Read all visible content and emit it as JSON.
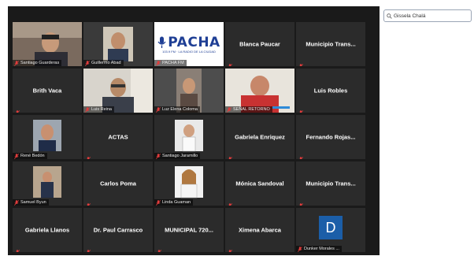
{
  "search": {
    "value": "Gissela Chalá",
    "placeholder": ""
  },
  "colors": {
    "gallery_bg": "#1a1a1a",
    "tile_bg": "#2b2b2b",
    "muted_red": "#e03c3c",
    "avatar_blue": "#1b5ea8"
  },
  "logo": {
    "text": "PACHA",
    "tagline": "103.9 FM · LA RADIO DE LA CIUDAD"
  },
  "avatar_letter": "D",
  "tiles": [
    {
      "name": "Santiago Guarderas",
      "label": "Santiago Guarderas",
      "mode": "video"
    },
    {
      "name": "Guillermo Abad",
      "label": "Guillermo Abad",
      "mode": "video"
    },
    {
      "name": "PACHA FM",
      "label": "PACHA FM",
      "mode": "logo"
    },
    {
      "name": "Blanca Paucar",
      "label": "",
      "mode": "name"
    },
    {
      "name": "Municipio Trans...",
      "label": "",
      "mode": "name"
    },
    {
      "name": "Brith Vaca",
      "label": "",
      "mode": "name"
    },
    {
      "name": "Luis Reina",
      "label": "Luis Reina",
      "mode": "video"
    },
    {
      "name": "Luz Elena Coloma",
      "label": "Luz Elena Coloma",
      "mode": "video"
    },
    {
      "name": "SEÑAL RETORNO",
      "label": "SEÑAL RETORNO",
      "mode": "video"
    },
    {
      "name": "Luis Robles",
      "label": "",
      "mode": "name"
    },
    {
      "name": "René Bedón",
      "label": "René Bedón",
      "mode": "video"
    },
    {
      "name": "ACTAS",
      "label": "",
      "mode": "name"
    },
    {
      "name": "Santiago Jaramillo",
      "label": "Santiago Jaramillo",
      "mode": "video"
    },
    {
      "name": "Gabriela Enriquez",
      "label": "",
      "mode": "name"
    },
    {
      "name": "Fernando Rojas...",
      "label": "",
      "mode": "name"
    },
    {
      "name": "Samuel Byun",
      "label": "Samuel Byun",
      "mode": "video"
    },
    {
      "name": "Carlos Poma",
      "label": "",
      "mode": "name"
    },
    {
      "name": "Linda Guaman",
      "label": "Linda Guaman",
      "mode": "video"
    },
    {
      "name": "Mónica Sandoval",
      "label": "",
      "mode": "name"
    },
    {
      "name": "Municipio Trans...",
      "label": "",
      "mode": "name"
    },
    {
      "name": "Gabriela Llanos",
      "label": "",
      "mode": "name"
    },
    {
      "name": "Dr. Paul Carrasco",
      "label": "",
      "mode": "name"
    },
    {
      "name": "MUNICIPAL 720...",
      "label": "",
      "mode": "name"
    },
    {
      "name": "Ximena Abarca",
      "label": "",
      "mode": "name"
    },
    {
      "name": "Dunker Morales",
      "label": "Dunker Morales ...",
      "mode": "avatar"
    }
  ]
}
